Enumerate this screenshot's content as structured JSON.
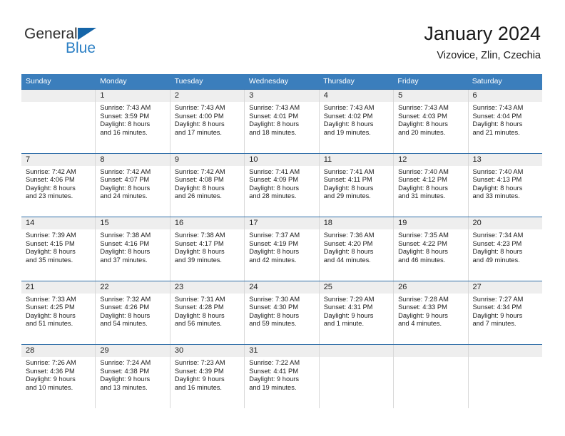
{
  "brand": {
    "name_primary": "General",
    "name_secondary": "Blue",
    "flag_icon": "triangle-flag-icon",
    "primary_color": "#1565a8",
    "secondary_color": "#2b7fc4"
  },
  "header": {
    "title": "January 2024",
    "subtitle": "Vizovice, Zlin, Czechia"
  },
  "theme": {
    "header_row_bg": "#3b7ebc",
    "week_divider": "#2f6ea8",
    "day_number_bg": "#eeeeee",
    "cell_border": "#d8d8d8"
  },
  "weekdays": [
    "Sunday",
    "Monday",
    "Tuesday",
    "Wednesday",
    "Thursday",
    "Friday",
    "Saturday"
  ],
  "weeks": [
    [
      {
        "day": "",
        "sunrise": "",
        "sunset": "",
        "daylight_line1": "",
        "daylight_line2": ""
      },
      {
        "day": "1",
        "sunrise": "Sunrise: 7:43 AM",
        "sunset": "Sunset: 3:59 PM",
        "daylight_line1": "Daylight: 8 hours",
        "daylight_line2": "and 16 minutes."
      },
      {
        "day": "2",
        "sunrise": "Sunrise: 7:43 AM",
        "sunset": "Sunset: 4:00 PM",
        "daylight_line1": "Daylight: 8 hours",
        "daylight_line2": "and 17 minutes."
      },
      {
        "day": "3",
        "sunrise": "Sunrise: 7:43 AM",
        "sunset": "Sunset: 4:01 PM",
        "daylight_line1": "Daylight: 8 hours",
        "daylight_line2": "and 18 minutes."
      },
      {
        "day": "4",
        "sunrise": "Sunrise: 7:43 AM",
        "sunset": "Sunset: 4:02 PM",
        "daylight_line1": "Daylight: 8 hours",
        "daylight_line2": "and 19 minutes."
      },
      {
        "day": "5",
        "sunrise": "Sunrise: 7:43 AM",
        "sunset": "Sunset: 4:03 PM",
        "daylight_line1": "Daylight: 8 hours",
        "daylight_line2": "and 20 minutes."
      },
      {
        "day": "6",
        "sunrise": "Sunrise: 7:43 AM",
        "sunset": "Sunset: 4:04 PM",
        "daylight_line1": "Daylight: 8 hours",
        "daylight_line2": "and 21 minutes."
      }
    ],
    [
      {
        "day": "7",
        "sunrise": "Sunrise: 7:42 AM",
        "sunset": "Sunset: 4:06 PM",
        "daylight_line1": "Daylight: 8 hours",
        "daylight_line2": "and 23 minutes."
      },
      {
        "day": "8",
        "sunrise": "Sunrise: 7:42 AM",
        "sunset": "Sunset: 4:07 PM",
        "daylight_line1": "Daylight: 8 hours",
        "daylight_line2": "and 24 minutes."
      },
      {
        "day": "9",
        "sunrise": "Sunrise: 7:42 AM",
        "sunset": "Sunset: 4:08 PM",
        "daylight_line1": "Daylight: 8 hours",
        "daylight_line2": "and 26 minutes."
      },
      {
        "day": "10",
        "sunrise": "Sunrise: 7:41 AM",
        "sunset": "Sunset: 4:09 PM",
        "daylight_line1": "Daylight: 8 hours",
        "daylight_line2": "and 28 minutes."
      },
      {
        "day": "11",
        "sunrise": "Sunrise: 7:41 AM",
        "sunset": "Sunset: 4:11 PM",
        "daylight_line1": "Daylight: 8 hours",
        "daylight_line2": "and 29 minutes."
      },
      {
        "day": "12",
        "sunrise": "Sunrise: 7:40 AM",
        "sunset": "Sunset: 4:12 PM",
        "daylight_line1": "Daylight: 8 hours",
        "daylight_line2": "and 31 minutes."
      },
      {
        "day": "13",
        "sunrise": "Sunrise: 7:40 AM",
        "sunset": "Sunset: 4:13 PM",
        "daylight_line1": "Daylight: 8 hours",
        "daylight_line2": "and 33 minutes."
      }
    ],
    [
      {
        "day": "14",
        "sunrise": "Sunrise: 7:39 AM",
        "sunset": "Sunset: 4:15 PM",
        "daylight_line1": "Daylight: 8 hours",
        "daylight_line2": "and 35 minutes."
      },
      {
        "day": "15",
        "sunrise": "Sunrise: 7:38 AM",
        "sunset": "Sunset: 4:16 PM",
        "daylight_line1": "Daylight: 8 hours",
        "daylight_line2": "and 37 minutes."
      },
      {
        "day": "16",
        "sunrise": "Sunrise: 7:38 AM",
        "sunset": "Sunset: 4:17 PM",
        "daylight_line1": "Daylight: 8 hours",
        "daylight_line2": "and 39 minutes."
      },
      {
        "day": "17",
        "sunrise": "Sunrise: 7:37 AM",
        "sunset": "Sunset: 4:19 PM",
        "daylight_line1": "Daylight: 8 hours",
        "daylight_line2": "and 42 minutes."
      },
      {
        "day": "18",
        "sunrise": "Sunrise: 7:36 AM",
        "sunset": "Sunset: 4:20 PM",
        "daylight_line1": "Daylight: 8 hours",
        "daylight_line2": "and 44 minutes."
      },
      {
        "day": "19",
        "sunrise": "Sunrise: 7:35 AM",
        "sunset": "Sunset: 4:22 PM",
        "daylight_line1": "Daylight: 8 hours",
        "daylight_line2": "and 46 minutes."
      },
      {
        "day": "20",
        "sunrise": "Sunrise: 7:34 AM",
        "sunset": "Sunset: 4:23 PM",
        "daylight_line1": "Daylight: 8 hours",
        "daylight_line2": "and 49 minutes."
      }
    ],
    [
      {
        "day": "21",
        "sunrise": "Sunrise: 7:33 AM",
        "sunset": "Sunset: 4:25 PM",
        "daylight_line1": "Daylight: 8 hours",
        "daylight_line2": "and 51 minutes."
      },
      {
        "day": "22",
        "sunrise": "Sunrise: 7:32 AM",
        "sunset": "Sunset: 4:26 PM",
        "daylight_line1": "Daylight: 8 hours",
        "daylight_line2": "and 54 minutes."
      },
      {
        "day": "23",
        "sunrise": "Sunrise: 7:31 AM",
        "sunset": "Sunset: 4:28 PM",
        "daylight_line1": "Daylight: 8 hours",
        "daylight_line2": "and 56 minutes."
      },
      {
        "day": "24",
        "sunrise": "Sunrise: 7:30 AM",
        "sunset": "Sunset: 4:30 PM",
        "daylight_line1": "Daylight: 8 hours",
        "daylight_line2": "and 59 minutes."
      },
      {
        "day": "25",
        "sunrise": "Sunrise: 7:29 AM",
        "sunset": "Sunset: 4:31 PM",
        "daylight_line1": "Daylight: 9 hours",
        "daylight_line2": "and 1 minute."
      },
      {
        "day": "26",
        "sunrise": "Sunrise: 7:28 AM",
        "sunset": "Sunset: 4:33 PM",
        "daylight_line1": "Daylight: 9 hours",
        "daylight_line2": "and 4 minutes."
      },
      {
        "day": "27",
        "sunrise": "Sunrise: 7:27 AM",
        "sunset": "Sunset: 4:34 PM",
        "daylight_line1": "Daylight: 9 hours",
        "daylight_line2": "and 7 minutes."
      }
    ],
    [
      {
        "day": "28",
        "sunrise": "Sunrise: 7:26 AM",
        "sunset": "Sunset: 4:36 PM",
        "daylight_line1": "Daylight: 9 hours",
        "daylight_line2": "and 10 minutes."
      },
      {
        "day": "29",
        "sunrise": "Sunrise: 7:24 AM",
        "sunset": "Sunset: 4:38 PM",
        "daylight_line1": "Daylight: 9 hours",
        "daylight_line2": "and 13 minutes."
      },
      {
        "day": "30",
        "sunrise": "Sunrise: 7:23 AM",
        "sunset": "Sunset: 4:39 PM",
        "daylight_line1": "Daylight: 9 hours",
        "daylight_line2": "and 16 minutes."
      },
      {
        "day": "31",
        "sunrise": "Sunrise: 7:22 AM",
        "sunset": "Sunset: 4:41 PM",
        "daylight_line1": "Daylight: 9 hours",
        "daylight_line2": "and 19 minutes."
      },
      {
        "day": "",
        "sunrise": "",
        "sunset": "",
        "daylight_line1": "",
        "daylight_line2": ""
      },
      {
        "day": "",
        "sunrise": "",
        "sunset": "",
        "daylight_line1": "",
        "daylight_line2": ""
      },
      {
        "day": "",
        "sunrise": "",
        "sunset": "",
        "daylight_line1": "",
        "daylight_line2": ""
      }
    ]
  ]
}
